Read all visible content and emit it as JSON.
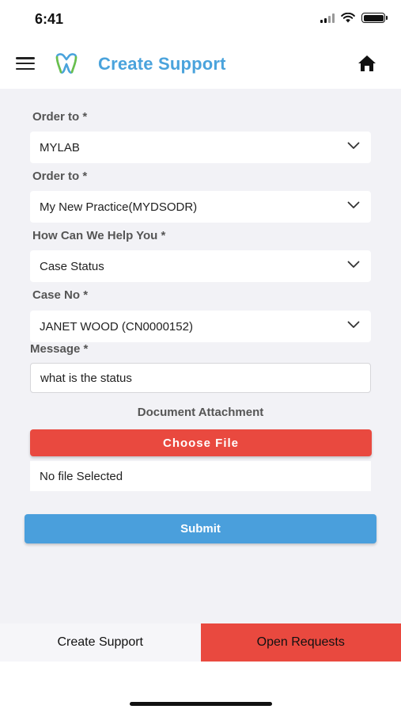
{
  "status_bar": {
    "time": "6:41"
  },
  "header": {
    "title": "Create Support",
    "menu_icon": "hamburger-menu-icon",
    "logo_icon": "tooth-logo-icon",
    "home_icon": "home-icon"
  },
  "form": {
    "order_to_1": {
      "label": "Order to *",
      "value": "MYLAB"
    },
    "order_to_2": {
      "label": "Order to *",
      "value": "My New Practice(MYDSODR)"
    },
    "help": {
      "label": "How Can We Help You *",
      "value": "Case Status"
    },
    "case_no": {
      "label": "Case No *",
      "value": "JANET WOOD (CN0000152)"
    },
    "message": {
      "label": "Message *",
      "value": "what is the status"
    },
    "attachment": {
      "label": "Document Attachment",
      "button": "Choose File",
      "status": "No file Selected"
    },
    "submit": "Submit"
  },
  "tabs": [
    {
      "label": "Create Support",
      "active": true
    },
    {
      "label": "Open Requests",
      "active": false
    }
  ],
  "colors": {
    "brand_blue": "#4aa3dc",
    "accent_red": "#e9493f",
    "submit_blue": "#4a9fdc",
    "form_bg": "#f2f2f6"
  }
}
